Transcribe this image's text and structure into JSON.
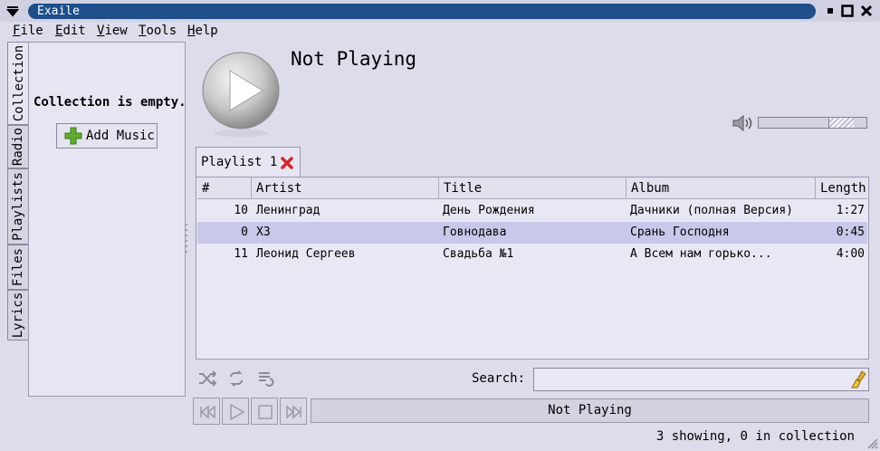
{
  "window": {
    "title": "Exaile"
  },
  "menu": {
    "items": [
      "File",
      "Edit",
      "View",
      "Tools",
      "Help"
    ]
  },
  "side_tabs": [
    "Collection",
    "Radio",
    "Playlists",
    "Files",
    "Lyrics"
  ],
  "collection": {
    "empty_text": "Collection is empty.",
    "add_music_label": "Add Music"
  },
  "now_playing": {
    "title": "Not Playing",
    "volume": 0.85
  },
  "playlist": {
    "tab_label": "Playlist 1",
    "columns": [
      "#",
      "Artist",
      "Title",
      "Album",
      "Length"
    ],
    "rows": [
      {
        "num": "10",
        "artist": "Ленинград",
        "title": "День Рождения",
        "album": "Дачники (полная Версия)",
        "length": "1:27",
        "selected": false
      },
      {
        "num": "0",
        "artist": "ХЗ",
        "title": "Говнодава",
        "album": "Срань Господня",
        "length": "0:45",
        "selected": true
      },
      {
        "num": "11",
        "artist": "Леонид Сергеев",
        "title": "Свадьба №1",
        "album": "А Всем нам горько...",
        "length": "4:00",
        "selected": false
      }
    ]
  },
  "search": {
    "label": "Search:",
    "value": ""
  },
  "status": {
    "playing_text": "Not Playing",
    "count_text": "3 showing, 0 in collection"
  },
  "colors": {
    "title_bar": "#1c4f8c",
    "background": "#dcdcea",
    "selected_row": "#c8c8ea",
    "close_tab": "#d8262a",
    "add_icon": "#5cae2a"
  }
}
